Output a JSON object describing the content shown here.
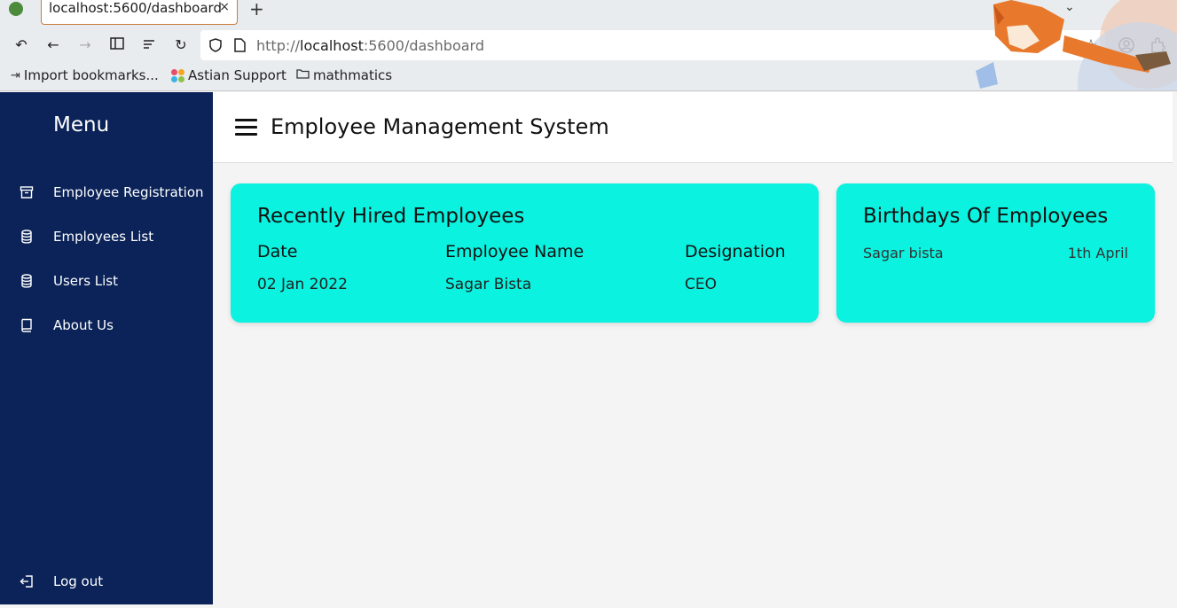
{
  "browser": {
    "tab_title": "localhost:5600/dashboard",
    "tab_close": "×",
    "new_tab": "+",
    "url_scheme": "http://",
    "url_host": "localhost",
    "url_rest": ":5600/dashboard",
    "bookmarks": [
      {
        "label": "Import bookmarks..."
      },
      {
        "label": "Astian Support"
      },
      {
        "label": "mathmatics"
      }
    ]
  },
  "sidebar": {
    "title": "Menu",
    "items": [
      {
        "label": "Employee Registration",
        "icon": "archive-icon"
      },
      {
        "label": "Employees List",
        "icon": "database-icon"
      },
      {
        "label": "Users List",
        "icon": "database-icon"
      },
      {
        "label": "About Us",
        "icon": "book-icon"
      }
    ],
    "logout": "Log out"
  },
  "header": {
    "title": "Employee Management System"
  },
  "recent_hires": {
    "title": "Recently Hired Employees",
    "columns": [
      "Date",
      "Employee Name",
      "Designation"
    ],
    "rows": [
      {
        "date": "02 Jan 2022",
        "name": "Sagar Bista",
        "designation": "CEO"
      }
    ]
  },
  "birthdays": {
    "title": "Birthdays Of Employees",
    "entries": [
      {
        "name": "Sagar bista",
        "date": "1th April"
      }
    ]
  },
  "colors": {
    "sidebar_bg": "#0b2358",
    "card_bg": "#0cf2e0",
    "page_bg": "#f4f4f4"
  }
}
